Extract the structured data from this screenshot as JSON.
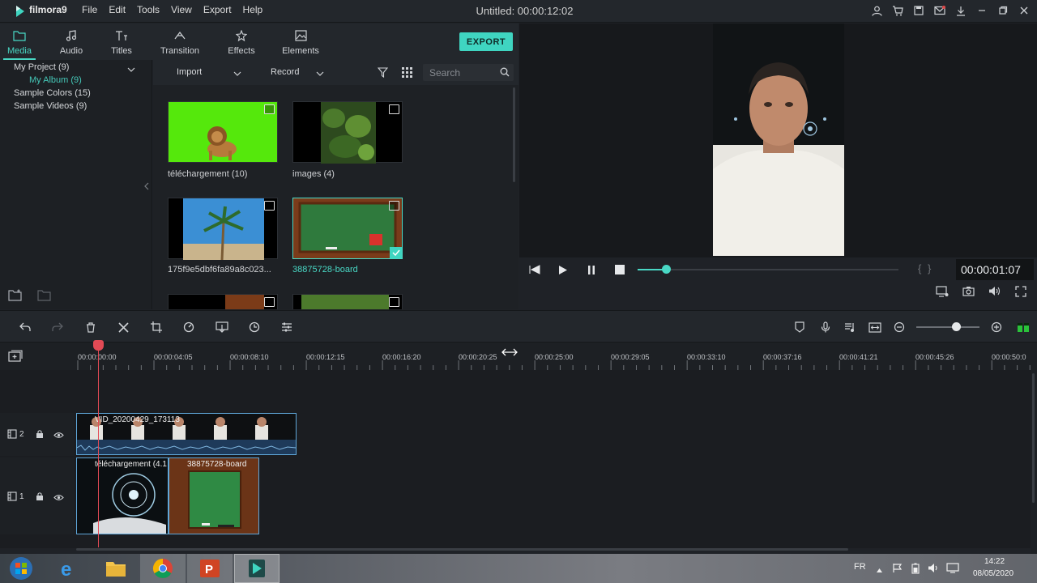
{
  "app": {
    "brand": "filmora9",
    "window_title": "Untitled: 00:00:12:02",
    "menu": [
      "File",
      "Edit",
      "Tools",
      "View",
      "Export",
      "Help"
    ]
  },
  "tabs": [
    {
      "label": "Media"
    },
    {
      "label": "Audio"
    },
    {
      "label": "Titles"
    },
    {
      "label": "Transition"
    },
    {
      "label": "Effects"
    },
    {
      "label": "Elements"
    }
  ],
  "export_label": "EXPORT",
  "tree": {
    "my_project": "My Project (9)",
    "my_album": "My Album (9)",
    "sample_colors": "Sample Colors (15)",
    "sample_videos": "Sample Videos (9)"
  },
  "media_bar": {
    "import_label": "Import",
    "record_label": "Record",
    "search_placeholder": "Search"
  },
  "media_items": [
    {
      "label": "téléchargement (10)"
    },
    {
      "label": "images (4)"
    },
    {
      "label": "175f9e5dbf6fa89a8c023..."
    },
    {
      "label": "38875728-board"
    }
  ],
  "preview": {
    "timecode": "00:00:01:07",
    "progress_fraction": 0.11,
    "brackets": "{   }"
  },
  "ruler": {
    "labels": [
      "00:00:00:00",
      "00:00:04:05",
      "00:00:08:10",
      "00:00:12:15",
      "00:00:16:20",
      "00:00:20:25",
      "00:00:25:00",
      "00:00:29:05",
      "00:00:33:10",
      "00:00:37:16",
      "00:00:41:21",
      "00:00:45:26",
      "00:00:50:0"
    ]
  },
  "tracks": {
    "track2_label": "2",
    "track1_label": "1",
    "clip_video": "VID_20200429_173113",
    "clip_tele": "téléchargement (4.1",
    "clip_board": "38875728-board"
  },
  "taskbar": {
    "lang": "FR",
    "time": "14:22",
    "date": "08/05/2020"
  },
  "colors": {
    "accent": "#49d8c5",
    "playhead": "#e24a55"
  }
}
